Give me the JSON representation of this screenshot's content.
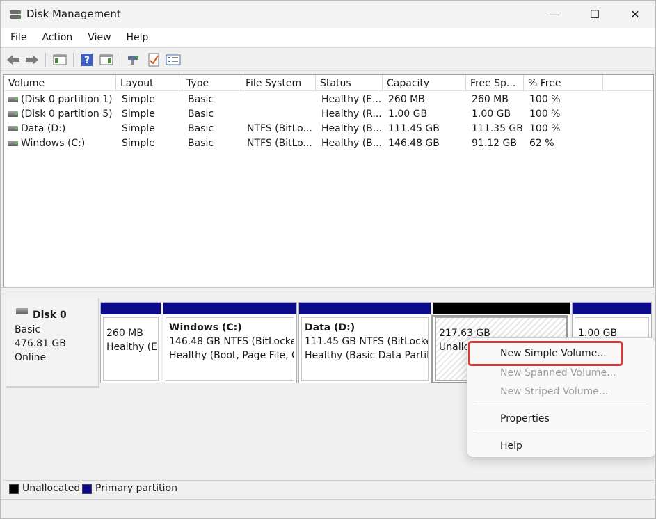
{
  "window": {
    "title": "Disk Management",
    "minimize_glyph": "—",
    "maximize_glyph": "☐",
    "close_glyph": "✕"
  },
  "menu": {
    "items": [
      {
        "label": "File"
      },
      {
        "label": "Action"
      },
      {
        "label": "View"
      },
      {
        "label": "Help"
      }
    ]
  },
  "toolbar": {
    "buttons": [
      "back-arrow-icon",
      "forward-arrow-icon",
      "console-tree-icon",
      "help-icon",
      "show-hide-pane-icon",
      "rescan-disks-icon",
      "checklist-icon",
      "properties-list-icon"
    ]
  },
  "volumes": {
    "columns": [
      "Volume",
      "Layout",
      "Type",
      "File System",
      "Status",
      "Capacity",
      "Free Sp...",
      "% Free"
    ],
    "rows": [
      {
        "volume": "(Disk 0 partition 1)",
        "layout": "Simple",
        "type": "Basic",
        "fs": "",
        "status": "Healthy (E...",
        "capacity": "260 MB",
        "free": "260 MB",
        "pct": "100 %"
      },
      {
        "volume": "(Disk 0 partition 5)",
        "layout": "Simple",
        "type": "Basic",
        "fs": "",
        "status": "Healthy (R...",
        "capacity": "1.00 GB",
        "free": "1.00 GB",
        "pct": "100 %"
      },
      {
        "volume": "Data (D:)",
        "layout": "Simple",
        "type": "Basic",
        "fs": "NTFS (BitLo...",
        "status": "Healthy (B...",
        "capacity": "111.45 GB",
        "free": "111.35 GB",
        "pct": "100 %"
      },
      {
        "volume": "Windows (C:)",
        "layout": "Simple",
        "type": "Basic",
        "fs": "NTFS (BitLo...",
        "status": "Healthy (B...",
        "capacity": "146.48 GB",
        "free": "91.12 GB",
        "pct": "62 %"
      }
    ]
  },
  "disk": {
    "name": "Disk 0",
    "kind": "Basic",
    "size": "476.81 GB",
    "state": "Online"
  },
  "partitions": [
    {
      "name": "",
      "line1": "260 MB",
      "line2": "Healthy (EFI"
    },
    {
      "name": "Windows  (C:)",
      "line1": "146.48 GB NTFS (BitLocker",
      "line2": "Healthy (Boot, Page File, C"
    },
    {
      "name": "Data  (D:)",
      "line1": "111.45 GB NTFS (BitLocke",
      "line2": "Healthy (Basic Data Partiti"
    },
    {
      "name": "",
      "line1": "217.63 GB",
      "line2": "Unallocated"
    },
    {
      "name": "",
      "line1": "1.00 GB",
      "line2": ""
    }
  ],
  "legend": {
    "unallocated": "Unallocated",
    "primary": "Primary partition"
  },
  "context_menu": {
    "new_simple": "New Simple Volume...",
    "new_spanned": "New Spanned Volume...",
    "new_striped": "New Striped Volume...",
    "properties": "Properties",
    "help": "Help"
  },
  "colors": {
    "primary_partition": "#0a0a8a",
    "unallocated": "#000000",
    "highlight": "#d93a3a"
  }
}
